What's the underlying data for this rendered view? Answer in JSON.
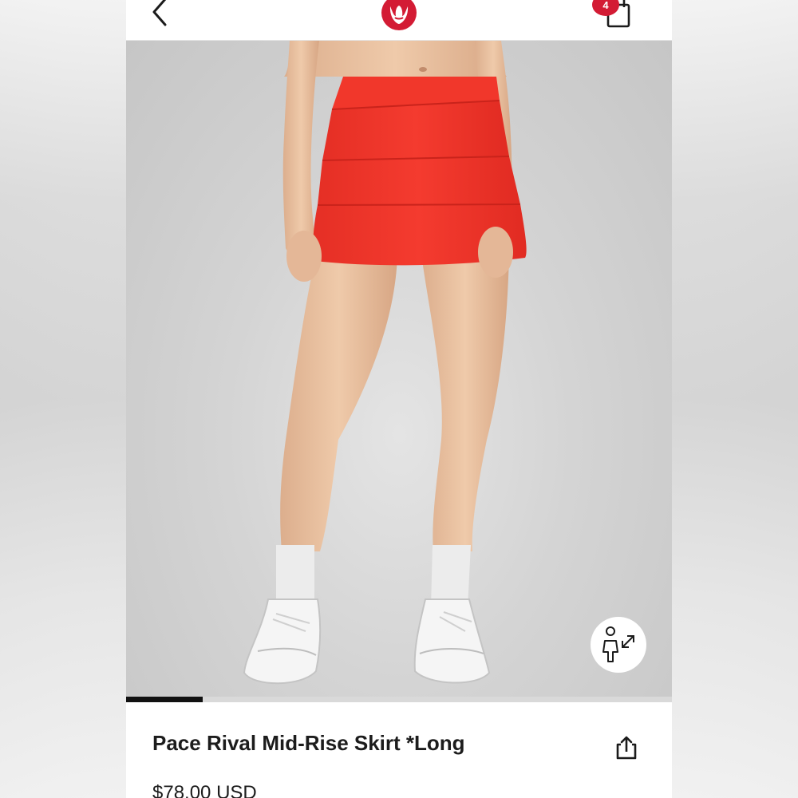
{
  "header": {
    "back_icon": "chevron-left-icon",
    "logo_icon": "lululemon-logo-icon",
    "bag_icon": "shopping-bag-icon",
    "bag_count": "4",
    "brand_color": "#d31b34"
  },
  "hero": {
    "skirt_color": "#f1372b",
    "background_color": "#d2d2d2",
    "fit_icon": "model-size-compare-icon",
    "gallery_progress": 0.14
  },
  "product": {
    "title": "Pace Rival Mid-Rise Skirt *Long",
    "price": "$78.00 USD",
    "share_icon": "share-icon"
  }
}
